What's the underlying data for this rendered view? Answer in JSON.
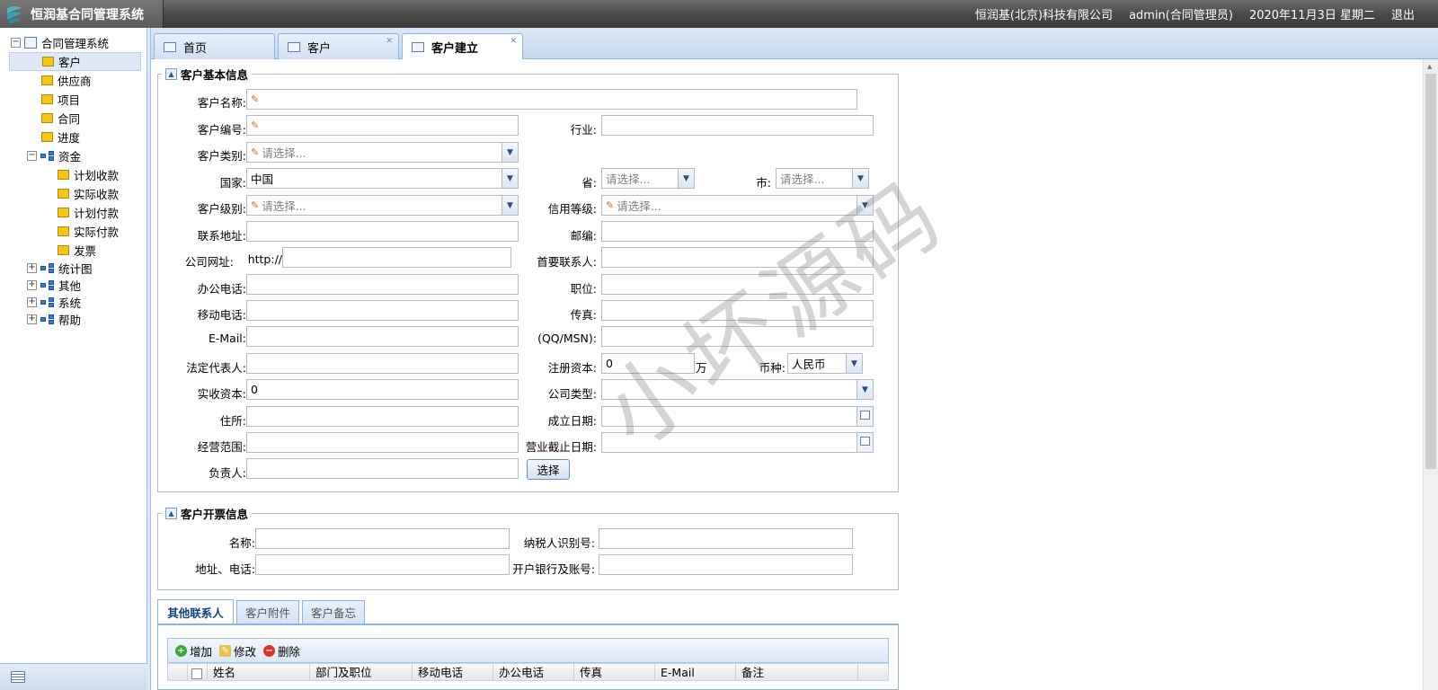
{
  "app": {
    "title": "恒润基合同管理系统",
    "company": "恒润基(北京)科技有限公司",
    "user": "admin(合同管理员)",
    "date": "2020年11月3日 星期二",
    "logout": "退出"
  },
  "sidebar": {
    "root": "合同管理系统",
    "items": [
      {
        "label": "客户"
      },
      {
        "label": "供应商"
      },
      {
        "label": "项目"
      },
      {
        "label": "合同"
      },
      {
        "label": "进度"
      }
    ],
    "funds": {
      "label": "资金",
      "children": [
        "计划收款",
        "实际收款",
        "计划付款",
        "实际付款",
        "发票"
      ]
    },
    "groups": [
      "统计图",
      "其他",
      "系统",
      "帮助"
    ]
  },
  "tabs": [
    "首页",
    "客户",
    "客户建立"
  ],
  "basic_info": {
    "legend": "客户基本信息",
    "labels": {
      "name": "客户名称:",
      "code": "客户编号:",
      "industry": "行业:",
      "category": "客户类别:",
      "country": "国家:",
      "province": "省:",
      "city": "市:",
      "level": "客户级别:",
      "credit": "信用等级:",
      "address": "联系地址:",
      "zip": "邮编:",
      "website": "公司网址:",
      "website_prefix": "http://",
      "primary_contact": "首要联系人:",
      "office_phone": "办公电话:",
      "position": "职位:",
      "mobile": "移动电话:",
      "fax": "传真:",
      "email": "E-Mail:",
      "qq": "(QQ/MSN):",
      "legal_rep": "法定代表人:",
      "reg_capital": "注册资本:",
      "wan": "万",
      "currency": "币种:",
      "paid_capital": "实收资本:",
      "company_type": "公司类型:",
      "residence": "住所:",
      "founded": "成立日期:",
      "scope": "经营范围:",
      "expiry": "营业截止日期:",
      "owner": "负责人:"
    },
    "values": {
      "country": "中国",
      "reg_capital": "0",
      "currency": "人民币",
      "paid_capital": "0"
    },
    "placeholders": {
      "select": "请选择..."
    },
    "select_button": "选择"
  },
  "invoice_info": {
    "legend": "客户开票信息",
    "labels": {
      "name": "名称:",
      "tax_id": "纳税人识别号:",
      "addr_phone": "地址、电话:",
      "bank": "开户银行及账号:"
    }
  },
  "lower_tabs": [
    "其他联系人",
    "客户附件",
    "客户备忘"
  ],
  "toolbar": {
    "add": "增加",
    "edit": "修改",
    "delete": "删除"
  },
  "grid_columns": [
    "姓名",
    "部门及职位",
    "移动电话",
    "办公电话",
    "传真",
    "E-Mail",
    "备注"
  ],
  "watermark": "小坏源码",
  "colors": {
    "accent": "#99bbe8",
    "header": "#4a4a4a"
  }
}
